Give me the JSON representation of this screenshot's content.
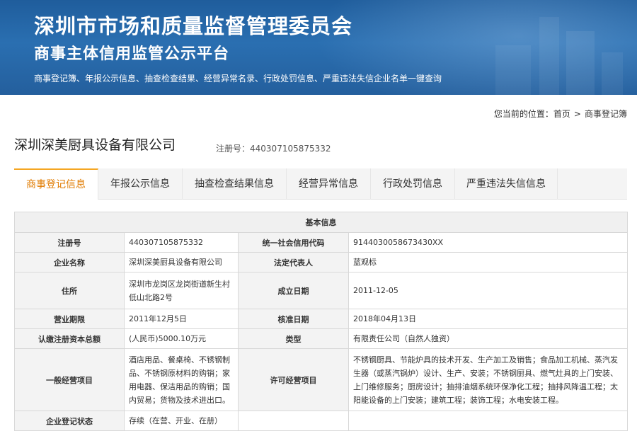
{
  "header": {
    "title_line1": "深圳市市场和质量监督管理委员会",
    "title_line2": "商事主体信用监管公示平台",
    "subtitle": "商事登记簿、年报公示信息、抽查检查结果、经营异常名录、行政处罚信息、严重违法失信企业名单一键查询"
  },
  "breadcrumb": {
    "prefix": "您当前的位置：",
    "home": "首页",
    "separator": ">",
    "current": "商事登记簿"
  },
  "company": {
    "name": "深圳深美厨具设备有限公司",
    "reg_label": "注册号：",
    "reg_value": "440307105875332"
  },
  "tabs": [
    {
      "label": "商事登记信息",
      "active": true
    },
    {
      "label": "年报公示信息",
      "active": false
    },
    {
      "label": "抽查检查结果信息",
      "active": false
    },
    {
      "label": "经营异常信息",
      "active": false
    },
    {
      "label": "行政处罚信息",
      "active": false
    },
    {
      "label": "严重违法失信信息",
      "active": false
    }
  ],
  "basic_info": {
    "section_title": "基本信息",
    "reg_no_label": "注册号",
    "reg_no": "440307105875332",
    "credit_code_label": "统一社会信用代码",
    "credit_code": "9144030058673430XX",
    "name_label": "企业名称",
    "name": "深圳深美厨具设备有限公司",
    "legal_rep_label": "法定代表人",
    "legal_rep": "蓝观标",
    "address_label": "住所",
    "address": "深圳市龙岗区龙岗街道新生村低山北路2号",
    "founded_label": "成立日期",
    "founded": "2011-12-05",
    "term_label": "营业期限",
    "term": "2011年12月5日",
    "approval_label": "核准日期",
    "approval": "2018年04月13日",
    "capital_label": "认缴注册资本总额",
    "capital": "(人民币)5000.10万元",
    "type_label": "类型",
    "type": "有限责任公司（自然人独资）",
    "general_scope_label": "一般经营项目",
    "general_scope": "酒店用品、餐桌椅、不锈钢制品、不锈钢原材料的购销；家用电器、保洁用品的购销；国内贸易；货物及技术进出口。",
    "licensed_scope_label": "许可经营项目",
    "licensed_scope": "不锈钢厨具、节能炉具的技术开发、生产加工及销售；食品加工机械、蒸汽发生器（或蒸汽锅炉）设计、生产、安装；不锈钢厨具、燃气灶具的上门安装、上门维修服务；厨房设计；抽排油烟系统环保净化工程；抽排风降温工程；太阳能设备的上门安装；建筑工程；装饰工程；水电安装工程。",
    "status_label": "企业登记状态",
    "status": "存续（在营、开业、在册）"
  }
}
